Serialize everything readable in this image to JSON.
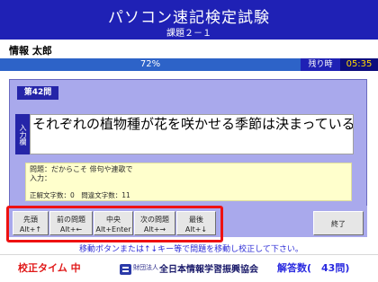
{
  "header": {
    "title": "パソコン速記検定試験",
    "subtitle": "課題２－１"
  },
  "user": {
    "name": "情報 太郎"
  },
  "progress": {
    "percent": 72,
    "label": "72%"
  },
  "timer": {
    "label": "残り時",
    "value": "05:35"
  },
  "question": {
    "number_label": "第42問"
  },
  "input": {
    "label": "入力欄",
    "text": "それぞれの植物種が花を咲かせる季節は決まっている"
  },
  "info": {
    "question_line": "問題：だからこそ 俳句や連歌で",
    "input_line": "入力：",
    "counts_line": "正解文字数：0　問違文字数：11"
  },
  "buttons": [
    {
      "label": "先頭",
      "shortcut": "Alt+↑"
    },
    {
      "label": "前の問題",
      "shortcut": "Alt+←"
    },
    {
      "label": "中央",
      "shortcut": "Alt+Enter"
    },
    {
      "label": "次の問題",
      "shortcut": "Alt+→"
    },
    {
      "label": "最後",
      "shortcut": "Alt+↓"
    }
  ],
  "end_button": {
    "label": "終了"
  },
  "notice": "移動ボタンまたは↑↓キー等で問題を移動し校正して下さい。",
  "footer": {
    "mode": "校正タイム 中",
    "org_prefix": "財団法人",
    "org_name": "全日本情報学習振興協会",
    "answer_count": "解答数(　43問)"
  },
  "colors": {
    "header_bg": "#1f21b5",
    "panel_bg": "#a9a9ec",
    "progress_bg": "#2d63c8",
    "highlight": "#ee1111",
    "timer_text": "#ffd800"
  },
  "icons": {
    "org_logo": "org-logo-icon"
  }
}
